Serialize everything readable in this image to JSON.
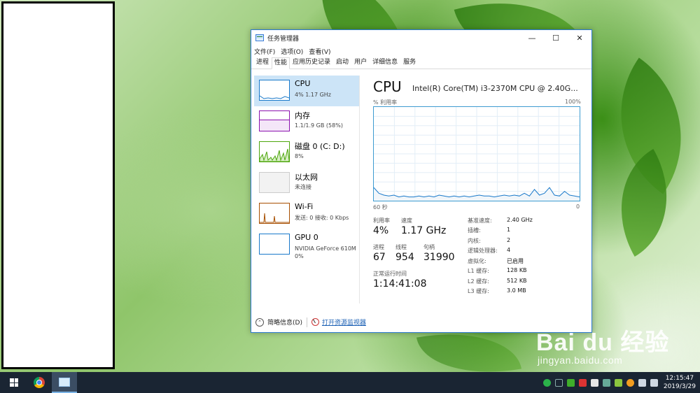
{
  "window": {
    "title": "任务管理器",
    "menu": [
      "文件(F)",
      "选项(O)",
      "查看(V)"
    ],
    "tabs": [
      "进程",
      "性能",
      "应用历史记录",
      "启动",
      "用户",
      "详细信息",
      "服务"
    ],
    "active_tab": "性能"
  },
  "sidebar": {
    "items": [
      {
        "name": "CPU",
        "sub": "4% 1.17 GHz",
        "color": "#1979ca",
        "selected": true
      },
      {
        "name": "内存",
        "sub": "1.1/1.9 GB (58%)",
        "color": "#8b12ae"
      },
      {
        "name": "磁盘 0 (C: D:)",
        "sub": "8%",
        "color": "#4da60c"
      },
      {
        "name": "以太网",
        "sub": "未连接",
        "color": "#cccccc"
      },
      {
        "name": "Wi-Fi",
        "sub": "发送: 0 接收: 0 Kbps",
        "color": "#a74f01"
      },
      {
        "name": "GPU 0",
        "sub": "NVIDIA GeForce 610M",
        "sub2": "0%",
        "color": "#1979ca"
      }
    ]
  },
  "cpu": {
    "title": "CPU",
    "model": "Intel(R) Core(TM) i3-2370M CPU @ 2.40G...",
    "util_label": "% 利用率",
    "util_max": "100%",
    "time_label": "60 秒",
    "time_end": "0",
    "stats": {
      "util_label": "利用率",
      "util_value": "4%",
      "speed_label": "速度",
      "speed_value": "1.17 GHz",
      "proc_label": "进程",
      "proc_value": "67",
      "thread_label": "线程",
      "thread_value": "954",
      "handle_label": "句柄",
      "handle_value": "31990",
      "uptime_label": "正常运行时间",
      "uptime_value": "1:14:41:08"
    },
    "specs": [
      {
        "label": "基准速度:",
        "value": "2.40 GHz"
      },
      {
        "label": "插槽:",
        "value": "1"
      },
      {
        "label": "内核:",
        "value": "2"
      },
      {
        "label": "逻辑处理器:",
        "value": "4"
      },
      {
        "label": "虚拟化:",
        "value": "已启用"
      },
      {
        "label": "L1 缓存:",
        "value": "128 KB"
      },
      {
        "label": "L2 缓存:",
        "value": "512 KB"
      },
      {
        "label": "L3 缓存:",
        "value": "3.0 MB"
      }
    ],
    "usage_history": [
      14,
      8,
      6,
      5,
      6,
      4,
      5,
      4,
      4,
      5,
      4,
      5,
      4,
      6,
      5,
      4,
      5,
      4,
      5,
      4,
      5,
      6,
      5,
      5,
      4,
      5,
      6,
      5,
      6,
      5,
      8,
      5,
      12,
      6,
      8,
      14,
      6,
      5,
      10,
      6,
      5,
      4
    ]
  },
  "footer": {
    "brief_label": "简略信息(D)",
    "monitor_link": "打开资源监视器"
  },
  "clock": {
    "time": "12:15:47",
    "date": "2019/3/29"
  },
  "watermark": {
    "main": "Bai du 经验",
    "sub": "jingyan.baidu.com"
  }
}
